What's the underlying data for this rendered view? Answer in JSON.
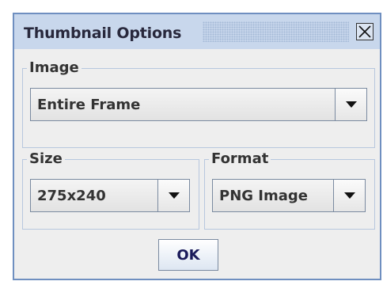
{
  "window": {
    "title": "Thumbnail Options"
  },
  "image_group": {
    "label": "Image",
    "selected": "Entire Frame"
  },
  "size_group": {
    "label": "Size",
    "selected": "275x240"
  },
  "format_group": {
    "label": "Format",
    "selected": "PNG Image"
  },
  "buttons": {
    "ok_label": "OK"
  },
  "icons": {
    "close": "close-icon",
    "dropdown": "chevron-down-icon"
  },
  "colors": {
    "title_bar": "#c8d7ec",
    "window_border": "#6f8fc0",
    "group_border": "#b7c7de",
    "background": "#eeeeee"
  }
}
